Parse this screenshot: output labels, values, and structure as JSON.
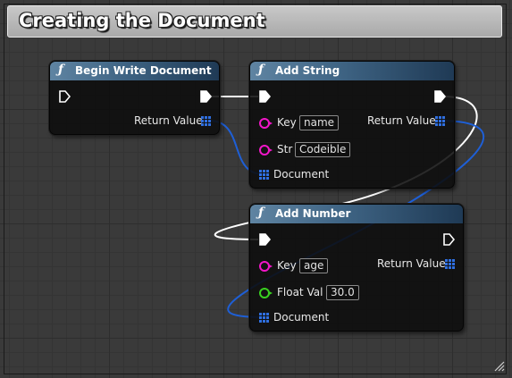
{
  "comment": {
    "title": "Creating the Document"
  },
  "nodes": {
    "begin_write": {
      "title": "Begin Write Document",
      "return_label": "Return Value"
    },
    "add_string": {
      "title": "Add String",
      "key_label": "Key",
      "key_value": "name",
      "str_label": "Str",
      "str_value": "Codeible",
      "return_label": "Return Value",
      "document_label": "Document"
    },
    "add_number": {
      "title": "Add Number",
      "key_label": "Key",
      "key_value": "age",
      "float_label": "Float Val",
      "float_value": "30.0",
      "return_label": "Return Value",
      "document_label": "Document"
    }
  },
  "icons": {
    "function": "function-icon",
    "exec": "exec-pin-icon",
    "string": "string-pin-icon",
    "float": "float-pin-icon",
    "struct": "struct-pin-icon"
  },
  "colors": {
    "header": "#3e6383",
    "string_pin": "#f216c8",
    "float_pin": "#39d120",
    "struct_pin": "#2f6fe0",
    "exec_wire": "#ffffff",
    "struct_wire": "#1e5fd6"
  }
}
